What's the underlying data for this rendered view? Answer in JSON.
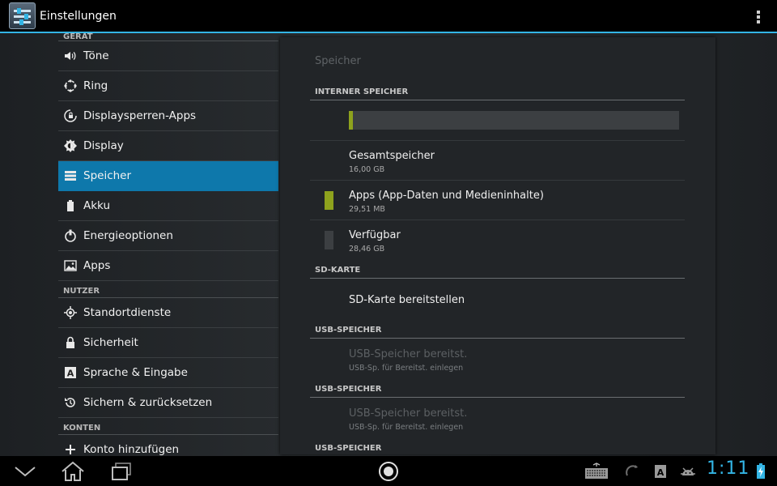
{
  "app": {
    "title": "Einstellungen"
  },
  "sidebar": {
    "sections": [
      {
        "header": "GERÄT",
        "items": [
          {
            "label": "Töne",
            "icon": "volume-icon"
          },
          {
            "label": "Ring",
            "icon": "ring-icon"
          },
          {
            "label": "Displaysperren-Apps",
            "icon": "lock-screen-icon"
          },
          {
            "label": "Display",
            "icon": "brightness-icon"
          },
          {
            "label": "Speicher",
            "icon": "storage-icon",
            "selected": true
          },
          {
            "label": "Akku",
            "icon": "battery-icon"
          },
          {
            "label": "Energieoptionen",
            "icon": "power-icon"
          },
          {
            "label": "Apps",
            "icon": "apps-icon"
          }
        ]
      },
      {
        "header": "NUTZER",
        "items": [
          {
            "label": "Standortdienste",
            "icon": "location-icon"
          },
          {
            "label": "Sicherheit",
            "icon": "lock-icon"
          },
          {
            "label": "Sprache & Eingabe",
            "icon": "keyboard-a-icon"
          },
          {
            "label": "Sichern & zurücksetzen",
            "icon": "restore-icon"
          }
        ]
      },
      {
        "header": "KONTEN",
        "items": [
          {
            "label": "Konto hinzufügen",
            "icon": "add-icon"
          }
        ]
      }
    ]
  },
  "storage": {
    "title": "Speicher",
    "internal": {
      "header": "INTERNER SPEICHER",
      "usage_fraction": 0.012,
      "used_color": "#8ea21d",
      "free_color": "#3c3f42",
      "total": {
        "label": "Gesamtspeicher",
        "value": "16,00 GB"
      },
      "apps": {
        "label": "Apps (App-Daten und Medieninhalte)",
        "value": "29,51 MB"
      },
      "available": {
        "label": "Verfügbar",
        "value": "28,46 GB"
      }
    },
    "sd_card": {
      "header": "SD-KARTE",
      "mount_label": "SD-Karte bereitstellen"
    },
    "usb": [
      {
        "header": "USB-SPEICHER",
        "label": "USB-Speicher bereitst.",
        "sub": "USB-Sp. für Bereitst. einlegen"
      },
      {
        "header": "USB-SPEICHER",
        "label": "USB-Speicher bereitst.",
        "sub": "USB-Sp. für Bereitst. einlegen"
      },
      {
        "header": "USB-SPEICHER"
      }
    ]
  },
  "system_bar": {
    "time": "1:11",
    "accent": "#33b5e5"
  }
}
